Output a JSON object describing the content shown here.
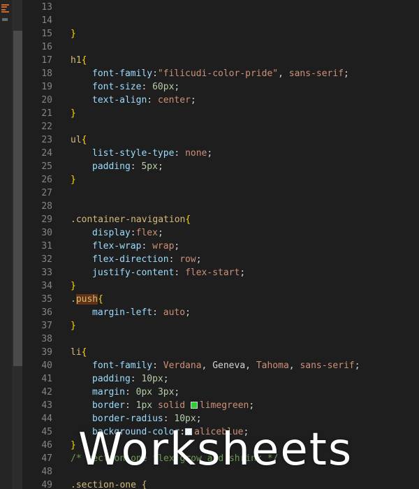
{
  "colors": {
    "background": "#1e1e1e",
    "selector": "#d7ba7d",
    "brace": "#ffd700",
    "property": "#9cdcfe",
    "value": "#ce9178",
    "number": "#b5cea8",
    "comment": "#6a9955",
    "line_number": "#858585",
    "limegreen_swatch": "#32cd32",
    "aliceblue_swatch": "#f0f8ff"
  },
  "sidebar": {
    "icon": "explorer-icon"
  },
  "code": {
    "lines": [
      {
        "n": "13",
        "tokens": []
      },
      {
        "n": "14",
        "tokens": []
      },
      {
        "n": "15",
        "tokens": [
          {
            "t": "}",
            "c": "brace"
          }
        ]
      },
      {
        "n": "16",
        "tokens": []
      },
      {
        "n": "17",
        "tokens": [
          {
            "t": "h1",
            "c": "sel"
          },
          {
            "t": "{",
            "c": "brace"
          }
        ]
      },
      {
        "n": "18",
        "indent": 1,
        "tokens": [
          {
            "t": "font-family",
            "c": "prop"
          },
          {
            "t": ":",
            "c": "punc"
          },
          {
            "t": "\"filicudi-color-pride\"",
            "c": "val"
          },
          {
            "t": ", ",
            "c": "punc"
          },
          {
            "t": "sans-serif",
            "c": "val"
          },
          {
            "t": ";",
            "c": "punc"
          }
        ]
      },
      {
        "n": "19",
        "indent": 1,
        "tokens": [
          {
            "t": "font-size",
            "c": "prop"
          },
          {
            "t": ": ",
            "c": "punc"
          },
          {
            "t": "60px",
            "c": "num"
          },
          {
            "t": ";",
            "c": "punc"
          }
        ]
      },
      {
        "n": "20",
        "indent": 1,
        "tokens": [
          {
            "t": "text-align",
            "c": "prop"
          },
          {
            "t": ": ",
            "c": "punc"
          },
          {
            "t": "center",
            "c": "val"
          },
          {
            "t": ";",
            "c": "punc"
          }
        ]
      },
      {
        "n": "21",
        "tokens": [
          {
            "t": "}",
            "c": "brace"
          }
        ]
      },
      {
        "n": "22",
        "tokens": []
      },
      {
        "n": "23",
        "tokens": [
          {
            "t": "ul",
            "c": "sel"
          },
          {
            "t": "{",
            "c": "brace"
          }
        ]
      },
      {
        "n": "24",
        "indent": 1,
        "tokens": [
          {
            "t": "list-style-type",
            "c": "prop"
          },
          {
            "t": ": ",
            "c": "punc"
          },
          {
            "t": "none",
            "c": "val"
          },
          {
            "t": ";",
            "c": "punc"
          }
        ]
      },
      {
        "n": "25",
        "indent": 1,
        "tokens": [
          {
            "t": "padding",
            "c": "prop"
          },
          {
            "t": ": ",
            "c": "punc"
          },
          {
            "t": "5px",
            "c": "num"
          },
          {
            "t": ";",
            "c": "punc"
          }
        ]
      },
      {
        "n": "26",
        "tokens": [
          {
            "t": "}",
            "c": "brace"
          }
        ]
      },
      {
        "n": "27",
        "tokens": []
      },
      {
        "n": "28",
        "tokens": []
      },
      {
        "n": "29",
        "tokens": [
          {
            "t": ".container-navigation",
            "c": "sel"
          },
          {
            "t": "{",
            "c": "brace"
          }
        ]
      },
      {
        "n": "30",
        "indent": 1,
        "tokens": [
          {
            "t": "display",
            "c": "prop"
          },
          {
            "t": ":",
            "c": "punc"
          },
          {
            "t": "flex",
            "c": "val"
          },
          {
            "t": ";",
            "c": "punc"
          }
        ]
      },
      {
        "n": "31",
        "indent": 1,
        "tokens": [
          {
            "t": "flex-wrap",
            "c": "prop"
          },
          {
            "t": ": ",
            "c": "punc"
          },
          {
            "t": "wrap",
            "c": "val"
          },
          {
            "t": ";",
            "c": "punc"
          }
        ]
      },
      {
        "n": "32",
        "indent": 1,
        "tokens": [
          {
            "t": "flex-direction",
            "c": "prop"
          },
          {
            "t": ": ",
            "c": "punc"
          },
          {
            "t": "row",
            "c": "val"
          },
          {
            "t": ";",
            "c": "punc"
          }
        ]
      },
      {
        "n": "33",
        "indent": 1,
        "tokens": [
          {
            "t": "justify-content",
            "c": "prop"
          },
          {
            "t": ": ",
            "c": "punc"
          },
          {
            "t": "flex-start",
            "c": "val"
          },
          {
            "t": ";",
            "c": "punc"
          }
        ]
      },
      {
        "n": "34",
        "tokens": [
          {
            "t": "}",
            "c": "brace"
          }
        ]
      },
      {
        "n": "35",
        "tokens": [
          {
            "t": ".",
            "c": "sel"
          },
          {
            "t": "push",
            "c": "sel",
            "hl": true
          },
          {
            "t": "{",
            "c": "brace"
          }
        ]
      },
      {
        "n": "36",
        "indent": 1,
        "tokens": [
          {
            "t": "margin-left",
            "c": "prop"
          },
          {
            "t": ": ",
            "c": "punc"
          },
          {
            "t": "auto",
            "c": "val"
          },
          {
            "t": ";",
            "c": "punc"
          }
        ]
      },
      {
        "n": "37",
        "tokens": [
          {
            "t": "}",
            "c": "brace"
          }
        ]
      },
      {
        "n": "38",
        "tokens": []
      },
      {
        "n": "39",
        "tokens": [
          {
            "t": "li",
            "c": "sel"
          },
          {
            "t": "{",
            "c": "brace"
          }
        ]
      },
      {
        "n": "40",
        "indent": 1,
        "tokens": [
          {
            "t": "font-family",
            "c": "prop"
          },
          {
            "t": ": ",
            "c": "punc"
          },
          {
            "t": "Verdana",
            "c": "val"
          },
          {
            "t": ", Geneva, ",
            "c": "punc"
          },
          {
            "t": "Tahoma",
            "c": "val"
          },
          {
            "t": ", ",
            "c": "punc"
          },
          {
            "t": "sans-serif",
            "c": "val"
          },
          {
            "t": ";",
            "c": "punc"
          }
        ]
      },
      {
        "n": "41",
        "indent": 1,
        "tokens": [
          {
            "t": "padding",
            "c": "prop"
          },
          {
            "t": ": ",
            "c": "punc"
          },
          {
            "t": "10px",
            "c": "num"
          },
          {
            "t": ";",
            "c": "punc"
          }
        ]
      },
      {
        "n": "42",
        "indent": 1,
        "tokens": [
          {
            "t": "margin",
            "c": "prop"
          },
          {
            "t": ": ",
            "c": "punc"
          },
          {
            "t": "0px",
            "c": "num"
          },
          {
            "t": " ",
            "c": "punc"
          },
          {
            "t": "3px",
            "c": "num"
          },
          {
            "t": ";",
            "c": "punc"
          }
        ]
      },
      {
        "n": "43",
        "indent": 1,
        "tokens": [
          {
            "t": "border",
            "c": "prop"
          },
          {
            "t": ": ",
            "c": "punc"
          },
          {
            "t": "1px",
            "c": "num"
          },
          {
            "t": " ",
            "c": "punc"
          },
          {
            "t": "solid",
            "c": "val"
          },
          {
            "t": " ",
            "c": "punc"
          },
          {
            "swatch": "#32cd32"
          },
          {
            "t": "limegreen",
            "c": "val"
          },
          {
            "t": ";",
            "c": "punc"
          }
        ]
      },
      {
        "n": "44",
        "indent": 1,
        "tokens": [
          {
            "t": "border-radius",
            "c": "prop"
          },
          {
            "t": ": ",
            "c": "punc"
          },
          {
            "t": "10px",
            "c": "num"
          },
          {
            "t": ";",
            "c": "punc"
          }
        ]
      },
      {
        "n": "45",
        "indent": 1,
        "tokens": [
          {
            "t": "background-color",
            "c": "prop"
          },
          {
            "t": ":",
            "c": "punc"
          },
          {
            "swatch": "#f0f8ff"
          },
          {
            "t": "aliceblue",
            "c": "val"
          },
          {
            "t": ";",
            "c": "punc"
          }
        ]
      },
      {
        "n": "46",
        "tokens": [
          {
            "t": "}",
            "c": "brace"
          }
        ]
      },
      {
        "n": "47",
        "tokens": [
          {
            "t": "/* section one flex grow and shrink */",
            "c": "cmt"
          }
        ]
      },
      {
        "n": "48",
        "tokens": []
      },
      {
        "n": "49",
        "tokens": [
          {
            "t": ".section-one {",
            "c": "sel"
          }
        ]
      }
    ]
  },
  "watermark": {
    "text": "Worksheets"
  }
}
